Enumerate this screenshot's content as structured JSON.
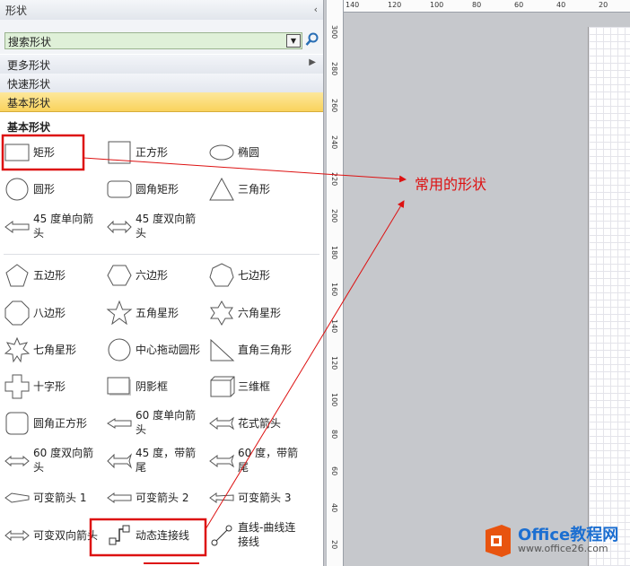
{
  "panel": {
    "title": "形状",
    "collapse": "‹"
  },
  "search": {
    "value": "搜索形状",
    "dropdown": "▼"
  },
  "menu": [
    {
      "label": "更多形状",
      "arrow": "▶"
    },
    {
      "label": "快速形状"
    },
    {
      "label": "基本形状",
      "active": true
    }
  ],
  "section_title": "基本形状",
  "shapes": {
    "rect": "矩形",
    "square": "正方形",
    "ellipse": "椭圆",
    "circle": "圆形",
    "rounded_rect": "圆角矩形",
    "triangle": "三角形",
    "arrow45_single": "45 度单向箭头",
    "arrow45_double": "45 度双向箭头",
    "pentagon": "五边形",
    "hexagon": "六边形",
    "heptagon": "七边形",
    "octagon": "八边形",
    "star5": "五角星形",
    "star6": "六角星形",
    "star7": "七角星形",
    "center_drag_circle": "中心拖动圆形",
    "right_triangle": "直角三角形",
    "cross": "十字形",
    "shadow_box": "阴影框",
    "3d_box": "三维框",
    "rounded_square": "圆角正方形",
    "arrow60_single": "60 度单向箭头",
    "fancy_arrow": "花式箭头",
    "arrow60_double": "60 度双向箭头",
    "arrow45_tail": "45 度，带箭尾",
    "arrow60_tail": "60 度，带箭尾",
    "var_arrow1": "可变箭头 1",
    "var_arrow2": "可变箭头 2",
    "var_arrow3": "可变箭头 3",
    "var_double_arrow": "可变双向箭头",
    "dynamic_connector": "动态连接线",
    "line_curve_connector": "直线-曲线连接线"
  },
  "ruler_h": [
    "140",
    "120",
    "100",
    "80",
    "60",
    "40",
    "20"
  ],
  "ruler_v": [
    "300",
    "280",
    "260",
    "240",
    "220",
    "200",
    "180",
    "160",
    "140",
    "120",
    "100",
    "80",
    "60",
    "40",
    "20"
  ],
  "annotation": "常用的形状",
  "logo": {
    "title": "Office教程网",
    "subtitle": "www.office26.com"
  },
  "colors": {
    "annotation": "#dd1111",
    "active_tab": "#f9d35c",
    "search_bg": "#dff0d8"
  }
}
